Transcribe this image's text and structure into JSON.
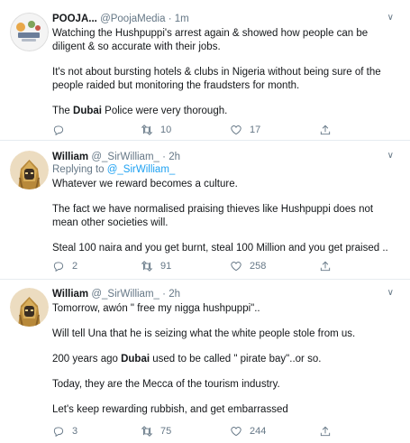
{
  "tweets": [
    {
      "name": "POOJA...",
      "handle": "@PoojaMedia",
      "dot": "·",
      "time": "1m",
      "reply_prefix": "",
      "reply_handle": "",
      "paragraphs": [
        "Watching the Hushpuppi's arrest again & showed how people can be diligent & so accurate with their jobs.",
        "It's not about bursting hotels & clubs in Nigeria without being sure of the people raided but monitoring the fraudsters for month.",
        "The {Dubai} Police were very thorough."
      ],
      "reply_count": "",
      "retweet_count": "10",
      "like_count": "17"
    },
    {
      "name": "William",
      "handle": "@_SirWilliam_",
      "dot": "·",
      "time": "2h",
      "reply_prefix": "Replying to ",
      "reply_handle": "@_SirWilliam_",
      "paragraphs": [
        "Whatever we reward becomes a culture.",
        "The fact we have normalised praising thieves like Hushpuppi does not mean other societies will.",
        "Steal 100 naira and you get burnt, steal 100 Million and you get praised .."
      ],
      "reply_count": "2",
      "retweet_count": "91",
      "like_count": "258"
    },
    {
      "name": "William",
      "handle": "@_SirWilliam_",
      "dot": "·",
      "time": "2h",
      "reply_prefix": "",
      "reply_handle": "",
      "paragraphs": [
        "Tomorrow, awón \" free my nigga hushpuppi\"..",
        "Will tell Una that he is seizing what the white people stole from us.",
        "200 years ago {Dubai} used to be called \" pirate bay\"..or so.",
        "Today, they are the Mecca of the tourism industry.",
        "Let's keep rewarding rubbish, and get embarrassed"
      ],
      "reply_count": "3",
      "retweet_count": "75",
      "like_count": "244"
    }
  ]
}
